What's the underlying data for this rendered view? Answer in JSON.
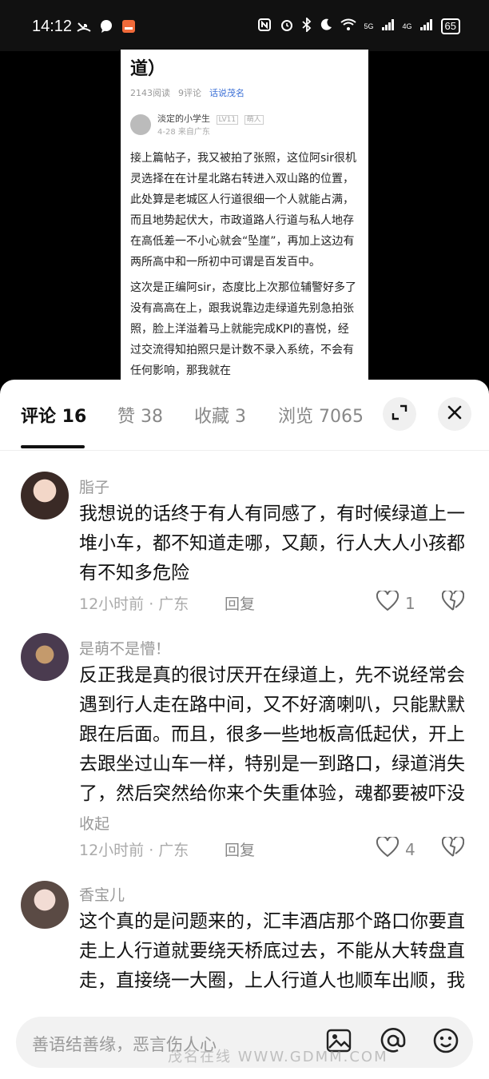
{
  "status_bar": {
    "time": "14:12",
    "network_5g": "5G",
    "network_4g": "4G",
    "battery": "65"
  },
  "article": {
    "title": "道）",
    "reads": "2143阅读",
    "comments": "9评论",
    "topic": "话说茂名",
    "author_name": "淡定的小学生",
    "author_level": "LV11",
    "author_badge": "萌人",
    "author_date": "4-28 来自广东",
    "paragraphs": [
      "接上篇帖子，我又被拍了张照，这位阿sir很机灵选择在在计星北路右转进入双山路的位置，此处算是老城区人行道很细一个人就能占满，而且地势起伏大，市政道路人行道与私人地存在高低差一不小心就会“坠崖”，再加上这边有两所高中和一所初中可谓是百发百中。",
      "这次是正编阿sir，态度比上次那位辅警好多了没有高高在上，跟我说靠边走绿道先别急拍张照，脸上洋溢着马上就能完成KPI的喜悦，经过交流得知拍照只是计数不录入系统，不会有任何影响，那我就在"
    ]
  },
  "tabs": [
    {
      "label": "评论 16",
      "active": true
    },
    {
      "label": "赞 38",
      "active": false
    },
    {
      "label": "收藏 3",
      "active": false
    },
    {
      "label": "浏览 7065",
      "active": false
    }
  ],
  "icons": {
    "expand": "expand-icon",
    "close": "close-icon",
    "image": "image-icon",
    "at": "at-icon",
    "emoji": "emoji-icon"
  },
  "comments": [
    {
      "name": "脂子",
      "text": "我想说的话终于有人有同感了，有时候绿道上一堆小车，都不知道走哪，又颠，行人大人小孩都有不知多危险",
      "collapse": "",
      "time": "12小时前 · 广东",
      "reply": "回复",
      "likes": "1"
    },
    {
      "name": "是萌不是懵！",
      "text": "反正我是真的很讨厌开在绿道上，先不说经常会遇到行人走在路中间，又不好滴喇叭，只能默默跟在后面。而且，很多一些地板高低起伏，开上去跟坐过山车一样，特别是一到路口，绿道消失了，然后突然给你来个失重体验，魂都要被吓没",
      "collapse": "收起",
      "time": "12小时前 · 广东",
      "reply": "回复",
      "likes": "4"
    },
    {
      "name": "香宝儿",
      "text": "这个真的是问题来的，汇丰酒店那个路口你要直走上人行道就要绕天桥底过去，不能从大转盘直走，直接绕一大圈，上人行道人也顺车出顺，我不是很理解😂",
      "collapse": "",
      "time": "",
      "reply": "",
      "likes": ""
    }
  ],
  "input": {
    "placeholder": "善语结善缘，恶言伤人心"
  },
  "watermark": "茂名在线 WWW.GDMM.COM"
}
